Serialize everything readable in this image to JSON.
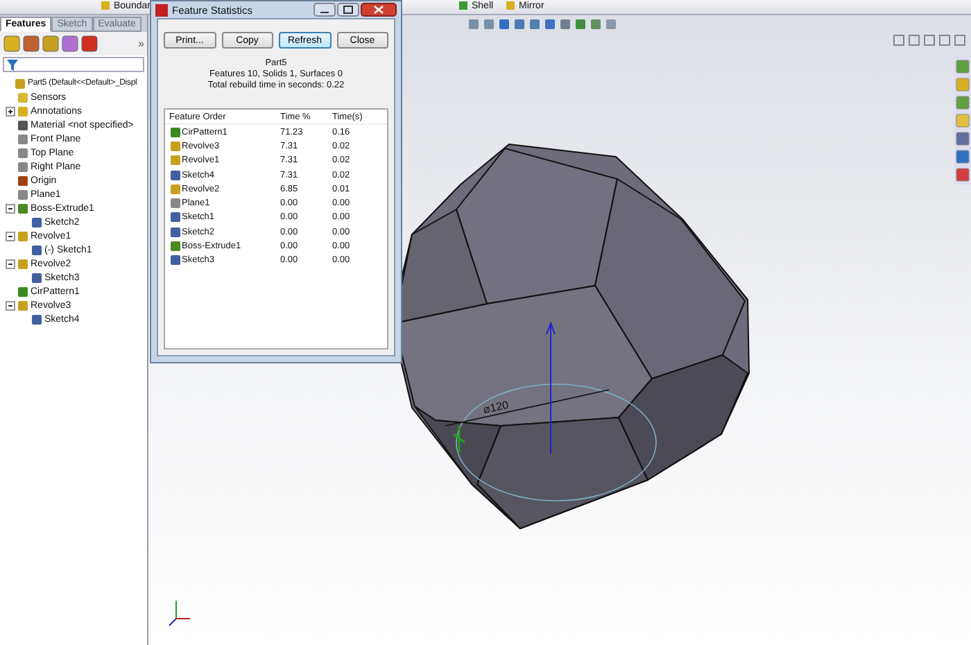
{
  "top_toolbar": {
    "items": [
      {
        "label": "Boundar",
        "kind": "boundary"
      },
      {
        "label": "Shell",
        "kind": "shell"
      },
      {
        "label": "Mirror",
        "kind": "mirror"
      }
    ]
  },
  "left_panel": {
    "tabs": [
      {
        "label": "Features",
        "selected": true
      },
      {
        "label": "Sketch",
        "selected": false
      },
      {
        "label": "Evaluate",
        "selected": false
      }
    ],
    "more": "»",
    "tree": {
      "label": "Part5  (Default<<Default>_Displ",
      "kind": "part",
      "children": [
        {
          "label": "Sensors",
          "kind": "sensor"
        },
        {
          "label": "Annotations",
          "kind": "annotation",
          "expanded": false
        },
        {
          "label": "Material <not specified>",
          "kind": "material"
        },
        {
          "label": "Front Plane",
          "kind": "plane"
        },
        {
          "label": "Top Plane",
          "kind": "plane"
        },
        {
          "label": "Right Plane",
          "kind": "plane"
        },
        {
          "label": "Origin",
          "kind": "origin"
        },
        {
          "label": "Plane1",
          "kind": "plane"
        },
        {
          "label": "Boss-Extrude1",
          "kind": "extrude",
          "expanded": true,
          "children": [
            {
              "label": "Sketch2",
              "kind": "sketch"
            }
          ]
        },
        {
          "label": "Revolve1",
          "kind": "revolve",
          "expanded": true,
          "children": [
            {
              "label": "(-) Sketch1",
              "kind": "sketch"
            }
          ]
        },
        {
          "label": "Revolve2",
          "kind": "revolve",
          "expanded": true,
          "children": [
            {
              "label": "Sketch3",
              "kind": "sketch"
            }
          ]
        },
        {
          "label": "CirPattern1",
          "kind": "pattern"
        },
        {
          "label": "Revolve3",
          "kind": "revolve",
          "expanded": true,
          "children": [
            {
              "label": "Sketch4",
              "kind": "sketch"
            }
          ]
        }
      ]
    }
  },
  "dialog": {
    "title": "Feature Statistics",
    "buttons": [
      {
        "label": "Print...",
        "focused": false
      },
      {
        "label": "Copy",
        "focused": false
      },
      {
        "label": "Refresh",
        "focused": true
      },
      {
        "label": "Close",
        "focused": false
      }
    ],
    "summary": [
      "Part5",
      "Features 10, Solids 1, Surfaces 0",
      "Total rebuild time in seconds: 0.22"
    ],
    "table": {
      "columns": [
        "Feature Order",
        "Time %",
        "Time(s)"
      ],
      "rows": [
        {
          "kind": "pattern",
          "cells": [
            "CirPattern1",
            "71.23",
            "0.16"
          ]
        },
        {
          "kind": "revolve",
          "cells": [
            "Revolve3",
            "7.31",
            "0.02"
          ]
        },
        {
          "kind": "revolve",
          "cells": [
            "Revolve1",
            "7.31",
            "0.02"
          ]
        },
        {
          "kind": "sketch",
          "cells": [
            "Sketch4",
            "7.31",
            "0.02"
          ]
        },
        {
          "kind": "revolve",
          "cells": [
            "Revolve2",
            "6.85",
            "0.01"
          ]
        },
        {
          "kind": "plane",
          "cells": [
            "Plane1",
            "0.00",
            "0.00"
          ]
        },
        {
          "kind": "sketch",
          "cells": [
            "Sketch1",
            "0.00",
            "0.00"
          ]
        },
        {
          "kind": "sketch",
          "cells": [
            "Sketch2",
            "0.00",
            "0.00"
          ]
        },
        {
          "kind": "extrude",
          "cells": [
            "Boss-Extrude1",
            "0.00",
            "0.00"
          ]
        },
        {
          "kind": "sketch",
          "cells": [
            "Sketch3",
            "0.00",
            "0.00"
          ]
        }
      ]
    }
  },
  "viewport": {
    "dimension": "⌀120"
  }
}
